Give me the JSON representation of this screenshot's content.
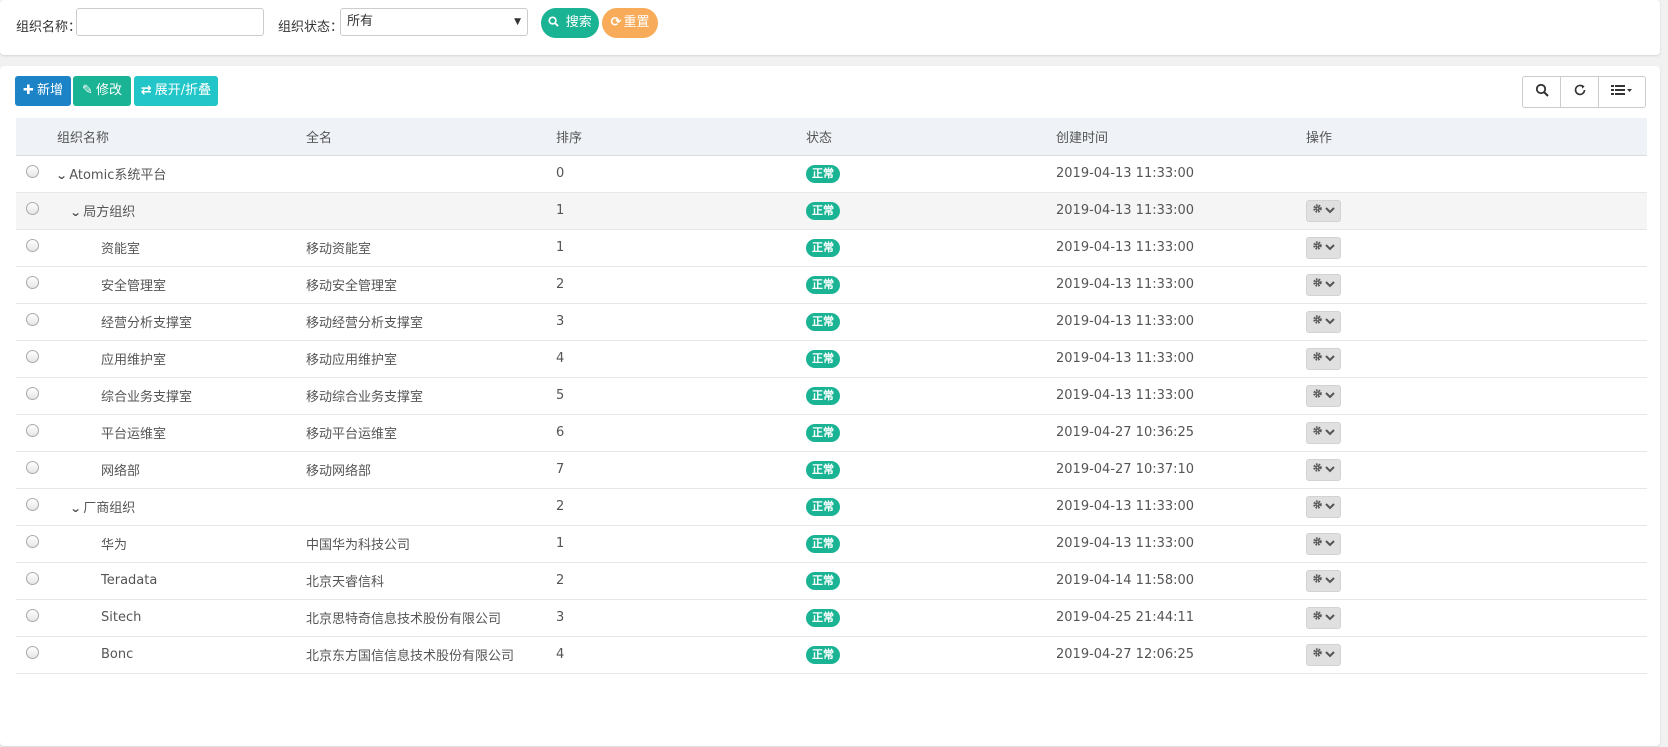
{
  "search": {
    "name_label": "组织名称：",
    "name_value": "",
    "name_placeholder": "",
    "status_label": "组织状态：",
    "status_selected": "所有",
    "search_button": "搜索",
    "reset_button": "重置"
  },
  "toolbar": {
    "add_label": "新增",
    "edit_label": "修改",
    "expand_label": "展开/折叠"
  },
  "colors": {
    "primary": "#1c84c6",
    "success": "#1ab394",
    "info": "#23c6c8",
    "warning": "#f8ac59",
    "badge": "#1ab394"
  },
  "table": {
    "headers": [
      "组织名称",
      "全名",
      "排序",
      "状态",
      "创建时间",
      "操作"
    ],
    "rows": [
      {
        "name": "Atomic系统平台",
        "full": "",
        "order": "0",
        "status": "正常",
        "created": "2019-04-13 11:33:00",
        "level": 0,
        "expandable": true,
        "op": false
      },
      {
        "name": "局方组织",
        "full": "",
        "order": "1",
        "status": "正常",
        "created": "2019-04-13 11:33:00",
        "level": 1,
        "expandable": true,
        "op": true
      },
      {
        "name": "资能室",
        "full": "移动资能室",
        "order": "1",
        "status": "正常",
        "created": "2019-04-13 11:33:00",
        "level": 2,
        "expandable": false,
        "op": true
      },
      {
        "name": "安全管理室",
        "full": "移动安全管理室",
        "order": "2",
        "status": "正常",
        "created": "2019-04-13 11:33:00",
        "level": 2,
        "expandable": false,
        "op": true
      },
      {
        "name": "经营分析支撑室",
        "full": "移动经营分析支撑室",
        "order": "3",
        "status": "正常",
        "created": "2019-04-13 11:33:00",
        "level": 2,
        "expandable": false,
        "op": true
      },
      {
        "name": "应用维护室",
        "full": "移动应用维护室",
        "order": "4",
        "status": "正常",
        "created": "2019-04-13 11:33:00",
        "level": 2,
        "expandable": false,
        "op": true
      },
      {
        "name": "综合业务支撑室",
        "full": "移动综合业务支撑室",
        "order": "5",
        "status": "正常",
        "created": "2019-04-13 11:33:00",
        "level": 2,
        "expandable": false,
        "op": true
      },
      {
        "name": "平台运维室",
        "full": "移动平台运维室",
        "order": "6",
        "status": "正常",
        "created": "2019-04-27 10:36:25",
        "level": 2,
        "expandable": false,
        "op": true
      },
      {
        "name": "网络部",
        "full": "移动网络部",
        "order": "7",
        "status": "正常",
        "created": "2019-04-27 10:37:10",
        "level": 2,
        "expandable": false,
        "op": true
      },
      {
        "name": "厂商组织",
        "full": "",
        "order": "2",
        "status": "正常",
        "created": "2019-04-13 11:33:00",
        "level": 1,
        "expandable": true,
        "op": true
      },
      {
        "name": "华为",
        "full": "中国华为科技公司",
        "order": "1",
        "status": "正常",
        "created": "2019-04-13 11:33:00",
        "level": 2,
        "expandable": false,
        "op": true
      },
      {
        "name": "Teradata",
        "full": "北京天睿信科",
        "order": "2",
        "status": "正常",
        "created": "2019-04-14 11:58:00",
        "level": 2,
        "expandable": false,
        "op": true
      },
      {
        "name": "Sitech",
        "full": "北京思特奇信息技术股份有限公司",
        "order": "3",
        "status": "正常",
        "created": "2019-04-25 21:44:11",
        "level": 2,
        "expandable": false,
        "op": true
      },
      {
        "name": "Bonc",
        "full": "北京东方国信信息技术股份有限公司",
        "order": "4",
        "status": "正常",
        "created": "2019-04-27 12:06:25",
        "level": 2,
        "expandable": false,
        "op": true
      }
    ]
  }
}
